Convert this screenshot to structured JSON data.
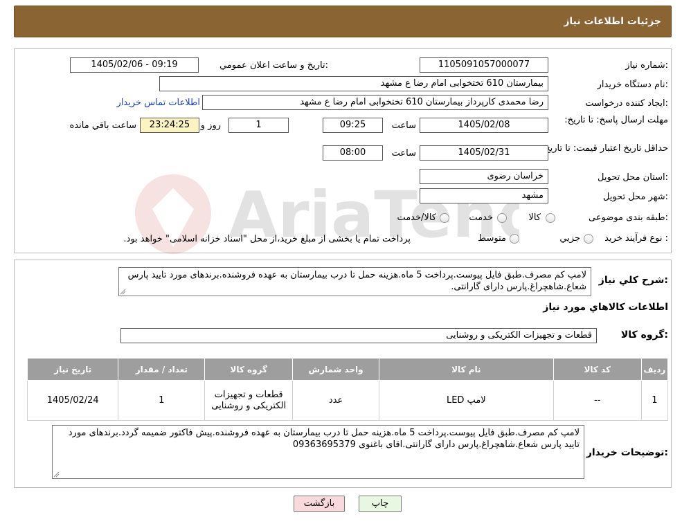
{
  "page": {
    "title": "جزئیات اطلاعات نیاز"
  },
  "info": {
    "need_number": {
      "label": "شماره نیاز:",
      "value": "1105091057000077"
    },
    "announce_datetime": {
      "label": "تاریخ و ساعت اعلان عمومي:",
      "value": "1405/02/06 - 09:19"
    },
    "buyer_org": {
      "label": "نام دستگاه خریدار:",
      "value": "بیمارستان 610 تختخوابی امام رضا ع  مشهد"
    },
    "requester": {
      "label": "ایجاد کننده درخواست:",
      "value": "رضا محمدی کارپرداز بیمارستان 610 تختخوابی امام رضا ع  مشهد",
      "contact_link": "اطلاعات تماس خریدار"
    },
    "reply_deadline": {
      "label": "مهلت ارسال پاسخ: تا تاریخ:",
      "date": "1405/02/08",
      "time_label": "ساعت",
      "time": "09:25",
      "days": "1",
      "days_label": "روز و",
      "remaining": "23:24:25",
      "remaining_label": "ساعت باقي مانده"
    },
    "price_validity": {
      "label": "حداقل تاریخ اعتبار قیمت: تا تاریخ:",
      "date": "1405/02/31",
      "time_label": "ساعت",
      "time": "08:00"
    },
    "province": {
      "label": "استان محل تحویل:",
      "value": "خراسان رضوی"
    },
    "city": {
      "label": "شهر محل تحویل:",
      "value": "مشهد"
    },
    "category": {
      "label": "طبقه بندی موضوعی:",
      "options": [
        "کالا",
        "خدمت",
        "کالا/خدمت"
      ]
    },
    "purchase_type": {
      "label": "نوع فرآیند خرید :",
      "options": [
        "جزیي",
        "متوسط"
      ],
      "note": "پرداخت تمام یا بخشی از مبلغ خرید،از محل \"اسناد خزانه اسلامی\" خواهد بود."
    }
  },
  "description": {
    "label": "شرح کلي نیاز:",
    "text": "لامپ کم مصرف.طبق فایل پیوست.پرداخت 5 ماه.هزینه حمل تا درب بیمارستان به عهده فروشنده.برندهای مورد تایید پارس شعاع.شاهچراغ.پارس دارای گارانتی."
  },
  "goods": {
    "section_title": "اطلاعات کالاهاي مورد نیاز",
    "group_label": "گروه کالا:",
    "group_value": "قطعات و تجهیزات الکتریکی و روشنایی",
    "table": {
      "headers": [
        "ردیف",
        "کد کالا",
        "نام کالا",
        "واحد شمارش",
        "گروه کالا",
        "تعداد / مقدار",
        "تاریخ نیاز"
      ],
      "rows": [
        [
          "1",
          "--",
          "لامپ LED",
          "عدد",
          "قطعات و تجهیزات الکتریکی و روشنایی",
          "1",
          "1405/02/24"
        ]
      ]
    },
    "buyer_notes_label": "توضیحات خریدار:",
    "buyer_notes": "لامپ کم مصرف.طبق فایل پیوست.پرداخت 5 ماه.هزینه حمل تا درب بیمارستان به عهده فروشنده.پیش فاکتور ضمیمه گردد.برندهای مورد تایید پارس شعاع.شاهچراغ.پارس دارای گارانتی.اقای باغنوی 09363695379"
  },
  "buttons": {
    "print": "چاپ",
    "back": "بازگشت"
  },
  "colors": {
    "header": "#8b6434",
    "link": "#1a3fb5",
    "table_header": "#9e9e9e",
    "remaining_bg": "#fbf4c0",
    "back_button": "#f9d9d9",
    "print_button": "#e7f7e1"
  }
}
